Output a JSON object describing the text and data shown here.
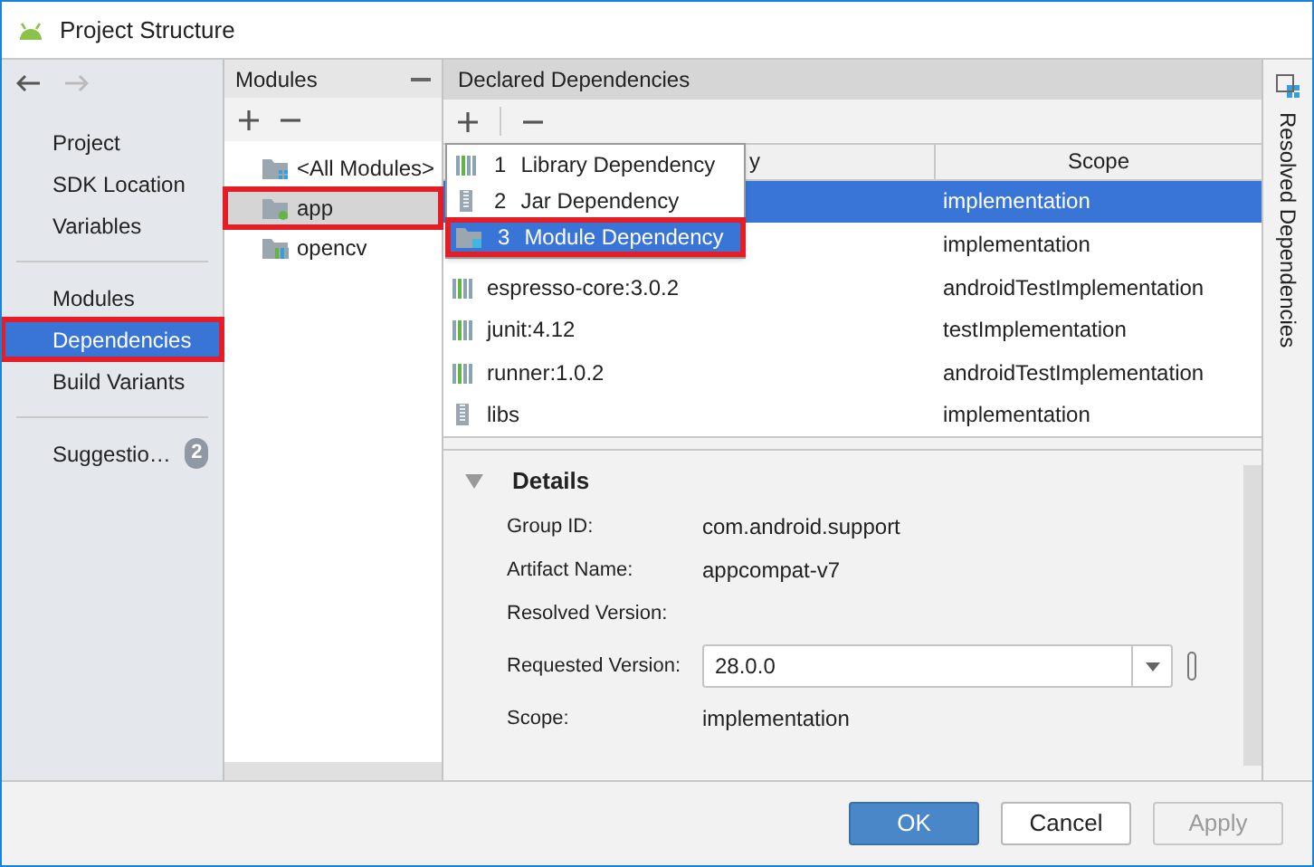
{
  "window": {
    "title": "Project Structure"
  },
  "sidebar": {
    "groups": [
      {
        "items": [
          {
            "label": "Project",
            "selected": false,
            "highlighted": false
          },
          {
            "label": "SDK Location",
            "selected": false,
            "highlighted": false
          },
          {
            "label": "Variables",
            "selected": false,
            "highlighted": false
          }
        ]
      },
      {
        "items": [
          {
            "label": "Modules",
            "selected": false,
            "highlighted": false
          },
          {
            "label": "Dependencies",
            "selected": true,
            "highlighted": true
          },
          {
            "label": "Build Variants",
            "selected": false,
            "highlighted": false
          }
        ]
      },
      {
        "items": [
          {
            "label": "Suggestio…",
            "selected": false,
            "highlighted": false,
            "badge": "2"
          }
        ]
      }
    ]
  },
  "modules": {
    "title": "Modules",
    "items": [
      {
        "label": "<All Modules>",
        "kind": "all",
        "selected": false,
        "highlighted": false
      },
      {
        "label": "app",
        "kind": "app",
        "selected": true,
        "highlighted": true
      },
      {
        "label": "opencv",
        "kind": "library",
        "selected": false,
        "highlighted": false
      }
    ]
  },
  "dependencies": {
    "title": "Declared Dependencies",
    "columns": [
      "y",
      "Scope"
    ],
    "rows": [
      {
        "scope": "implementation",
        "selected": true
      },
      {
        "scope": "implementation",
        "selected": false
      },
      {
        "name": "espresso-core:3.0.2",
        "kind": "library",
        "scope": "androidTestImplementation",
        "selected": false
      },
      {
        "name": "junit:4.12",
        "kind": "library",
        "scope": "testImplementation",
        "selected": false
      },
      {
        "name": "runner:1.0.2",
        "kind": "library",
        "scope": "androidTestImplementation",
        "selected": false
      },
      {
        "name": "libs",
        "kind": "jar",
        "scope": "implementation",
        "selected": false
      }
    ]
  },
  "add_menu": [
    {
      "number": "1",
      "label": "Library Dependency",
      "kind": "library",
      "selected": false,
      "highlighted": false
    },
    {
      "number": "2",
      "label": "Jar Dependency",
      "kind": "jar",
      "selected": false,
      "highlighted": false
    },
    {
      "number": "3",
      "label": "Module Dependency",
      "kind": "module",
      "selected": true,
      "highlighted": true
    }
  ],
  "details": {
    "title": "Details",
    "expanded": true,
    "fields": [
      {
        "label": "Group ID:",
        "value": "com.android.support",
        "kind": "text"
      },
      {
        "label": "Artifact Name:",
        "value": "appcompat-v7",
        "kind": "text"
      },
      {
        "label": "Resolved Version:",
        "kind": "text"
      },
      {
        "label": "Requested Version:",
        "value": "28.0.0",
        "kind": "combo"
      },
      {
        "label": "Scope:",
        "value": "implementation",
        "kind": "text"
      }
    ]
  },
  "right_tab": "Resolved Dependencies",
  "buttons": [
    {
      "label": "OK",
      "kind": "primary",
      "disabled": false
    },
    {
      "label": "Cancel",
      "kind": "normal",
      "disabled": false
    },
    {
      "label": "Apply",
      "kind": "normal",
      "disabled": true
    }
  ]
}
